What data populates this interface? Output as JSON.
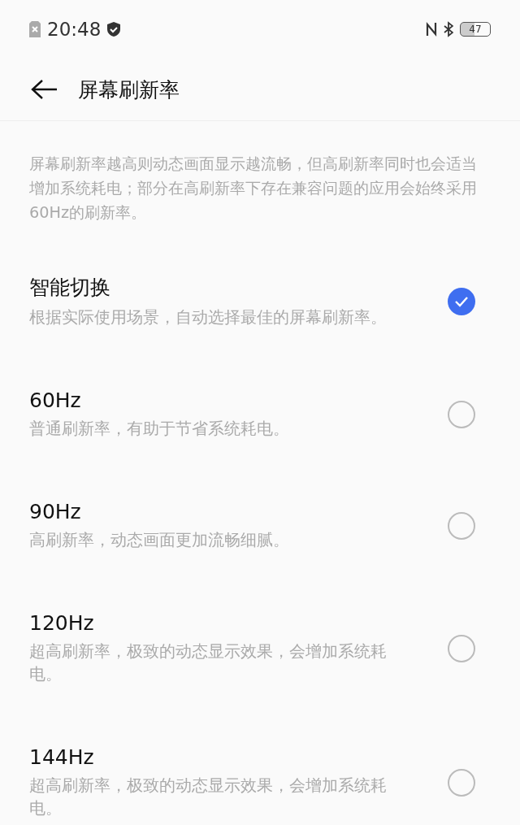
{
  "status_bar": {
    "time": "20:48",
    "battery": "47"
  },
  "header": {
    "title": "屏幕刷新率"
  },
  "description": "屏幕刷新率越高则动态画面显示越流畅，但高刷新率同时也会适当增加系统耗电；部分在高刷新率下存在兼容问题的应用会始终采用60Hz的刷新率。",
  "options": [
    {
      "title": "智能切换",
      "subtitle": "根据实际使用场景，自动选择最佳的屏幕刷新率。",
      "selected": true
    },
    {
      "title": "60Hz",
      "subtitle": "普通刷新率，有助于节省系统耗电。",
      "selected": false
    },
    {
      "title": "90Hz",
      "subtitle": "高刷新率，动态画面更加流畅细腻。",
      "selected": false
    },
    {
      "title": "120Hz",
      "subtitle": "超高刷新率，极致的动态显示效果，会增加系统耗电。",
      "selected": false
    },
    {
      "title": "144Hz",
      "subtitle": "超高刷新率，极致的动态显示效果，会增加系统耗电。",
      "selected": false
    }
  ]
}
